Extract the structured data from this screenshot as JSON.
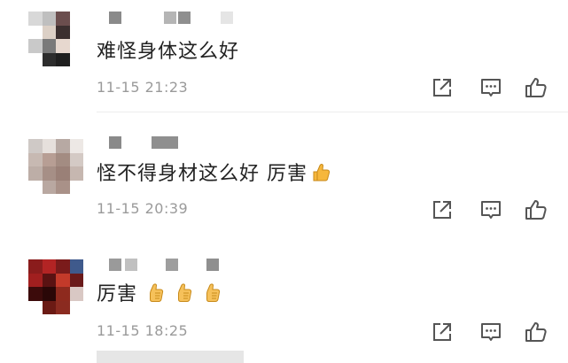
{
  "comments": [
    {
      "text": "难怪身体这么好",
      "time": "11-15 21:23",
      "thumbs": 0
    },
    {
      "text": "怪不得身材这么好 厉害",
      "time": "11-15 20:39",
      "thumbs": 1
    },
    {
      "text": "厉害",
      "time": "11-15 18:25",
      "thumbs": 3
    }
  ],
  "icons": {
    "share": "share-icon",
    "reply": "comment-icon",
    "like": "thumbs-up-icon",
    "emoji": "thumbs-up-emoji"
  },
  "colors": {
    "text": "#222222",
    "timestamp": "#9a9a9a",
    "icon": "#555555",
    "emoji": "#f6b73c"
  }
}
